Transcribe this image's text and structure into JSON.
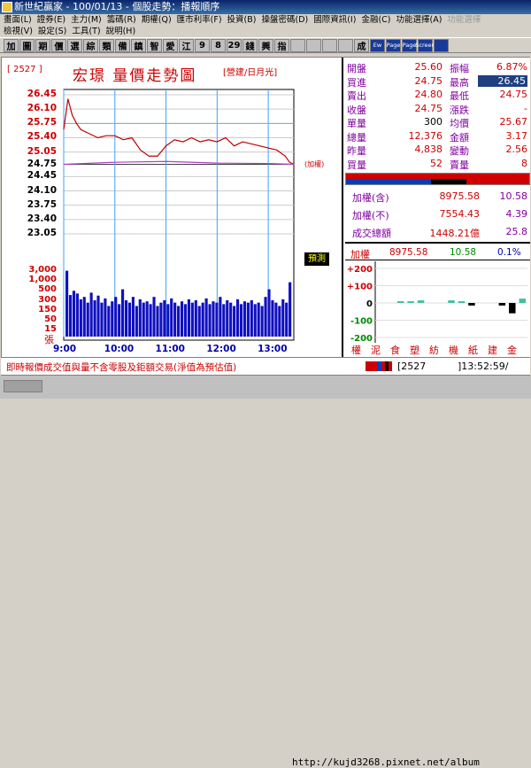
{
  "window": {
    "title": "新世紀贏家 - 100/01/13 - 個股走勢：播報順序"
  },
  "menu": {
    "row1": [
      {
        "label": "畫面(L)",
        "dim": false
      },
      {
        "label": "證券(E)",
        "dim": false
      },
      {
        "label": "主力(M)",
        "dim": false
      },
      {
        "label": "籌碼(R)",
        "dim": false
      },
      {
        "label": "期權(Q)",
        "dim": false
      },
      {
        "label": "匯市利率(F)",
        "dim": false
      },
      {
        "label": "投資(B)",
        "dim": false
      },
      {
        "label": "操盤密碼(D)",
        "dim": false
      },
      {
        "label": "國際資訊(I)",
        "dim": false
      },
      {
        "label": "金融(C)",
        "dim": false
      },
      {
        "label": "功能選擇(A)",
        "dim": false
      },
      {
        "label": "功能選擇",
        "dim": true
      }
    ],
    "row2": [
      {
        "label": "檢視(V)"
      },
      {
        "label": "設定(S)"
      },
      {
        "label": "工具(T)"
      },
      {
        "label": "說明(H)"
      }
    ]
  },
  "toolbar": {
    "buttons": [
      {
        "label": "加",
        "style": "normal"
      },
      {
        "label": "圖",
        "style": "normal"
      },
      {
        "label": "期",
        "style": "normal"
      },
      {
        "label": "價",
        "style": "normal"
      },
      {
        "label": "選",
        "style": "normal"
      },
      {
        "label": "綜",
        "style": "normal"
      },
      {
        "label": "類",
        "style": "normal"
      },
      {
        "label": "備",
        "style": "normal"
      },
      {
        "label": "鎮",
        "style": "normal"
      },
      {
        "label": "智",
        "style": "normal"
      },
      {
        "label": "愛",
        "style": "normal"
      },
      {
        "label": "江",
        "style": "normal"
      },
      {
        "label": "9",
        "style": "normal"
      },
      {
        "label": "8",
        "style": "normal"
      },
      {
        "label": "29",
        "style": "normal"
      },
      {
        "label": "錢",
        "style": "normal"
      },
      {
        "label": "興",
        "style": "normal"
      },
      {
        "label": "指",
        "style": "normal"
      },
      {
        "label": "",
        "style": "normal"
      },
      {
        "label": "",
        "style": "normal"
      },
      {
        "label": "",
        "style": "normal"
      },
      {
        "label": "",
        "style": "normal"
      },
      {
        "label": "成",
        "style": "normal"
      },
      {
        "label": "Ew",
        "style": "blue"
      },
      {
        "label": "Page",
        "style": "blue"
      },
      {
        "label": "Page",
        "style": "blue"
      },
      {
        "label": "Screen",
        "style": "blue"
      },
      {
        "label": "",
        "style": "blue"
      }
    ]
  },
  "stock": {
    "code": "[ 2527 ]",
    "name": "宏璟 量價走勢圖",
    "sector": "[營建/日月光]"
  },
  "chart_data": {
    "type": "line",
    "title": "宏璟 量價走勢圖",
    "xlabel": "",
    "ylabel": "",
    "x_ticks": [
      "9:00",
      "10:00",
      "11:00",
      "12:00",
      "13:00"
    ],
    "y_ticks": [
      "26.45",
      "26.10",
      "25.75",
      "25.40",
      "25.05",
      "24.75",
      "24.45",
      "24.10",
      "23.75",
      "23.40",
      "23.05"
    ],
    "ylim": [
      23.05,
      26.45
    ],
    "reference_price": 24.75,
    "series": [
      {
        "color": "#c00000",
        "x": [
          "9:00",
          "9:05",
          "9:10",
          "9:15",
          "9:20",
          "9:30",
          "9:40",
          "9:50",
          "10:00",
          "10:10",
          "10:20",
          "10:30",
          "10:40",
          "10:50",
          "11:00",
          "11:10",
          "11:20",
          "11:30",
          "11:40",
          "11:50",
          "12:00",
          "12:10",
          "12:20",
          "12:30",
          "12:40",
          "12:50",
          "13:00",
          "13:10",
          "13:20",
          "13:25",
          "13:30"
        ],
        "values": [
          25.6,
          26.35,
          25.95,
          25.75,
          25.6,
          25.5,
          25.4,
          25.45,
          25.45,
          25.35,
          25.4,
          25.1,
          24.95,
          24.95,
          25.2,
          25.35,
          25.3,
          25.4,
          25.3,
          25.35,
          25.3,
          25.4,
          25.2,
          25.3,
          25.25,
          25.2,
          25.15,
          25.1,
          24.95,
          24.8,
          24.75
        ]
      },
      {
        "color": "#b040c0",
        "x": [
          "9:00",
          "10:00",
          "11:00",
          "12:00",
          "13:00",
          "13:30"
        ],
        "values": [
          24.75,
          24.8,
          24.82,
          24.78,
          24.77,
          24.75
        ]
      }
    ],
    "annotations": [
      "(加權)",
      "預測"
    ],
    "volume": {
      "y_ticks": [
        "3,000",
        "1,000",
        "500",
        "300",
        "150",
        "50",
        "15"
      ],
      "unit": "張",
      "values": [
        2800,
        150,
        250,
        180,
        90,
        120,
        60,
        200,
        80,
        140,
        60,
        100,
        40,
        70,
        120,
        50,
        300,
        80,
        60,
        120,
        40,
        90,
        60,
        70,
        50,
        120,
        40,
        60,
        80,
        50,
        100,
        60,
        40,
        70,
        50,
        90,
        60,
        80,
        40,
        60,
        100,
        50,
        70,
        60,
        120,
        50,
        80,
        60,
        40,
        90,
        50,
        70,
        60,
        80,
        50,
        60,
        40,
        120,
        300,
        80,
        60,
        40,
        90,
        60,
        700
      ]
    }
  },
  "quote": {
    "rows": [
      {
        "l1": "開盤",
        "v1": "25.60",
        "l2": "振幅",
        "v2": "6.87%",
        "v2hl": false
      },
      {
        "l1": "買進",
        "v1": "24.75",
        "l2": "最高",
        "v2": "26.45",
        "v2hl": true
      },
      {
        "l1": "賣出",
        "v1": "24.80",
        "l2": "最低",
        "v2": "24.75",
        "v2hl": false
      },
      {
        "l1": "收盤",
        "v1": "24.75",
        "l2": "漲跌",
        "v2": "-",
        "v2hl": false
      },
      {
        "l1": "單量",
        "v1": "300",
        "l2": "均價",
        "v2": "25.67",
        "v2hl": false
      },
      {
        "l1": "總量",
        "v1": "12,376",
        "l2": "金額",
        "v2": "3.17",
        "v2hl": false
      },
      {
        "l1": "昨量",
        "v1": "4,838",
        "l2": "變動",
        "v2": "2.56",
        "v2hl": false
      },
      {
        "l1": "買量",
        "v1": "52",
        "l2": "賣量",
        "v2": "8",
        "v2hl": false
      }
    ]
  },
  "index": {
    "rows": [
      {
        "label": "加權(含)",
        "a": "8975.58",
        "b": "10.58"
      },
      {
        "label": "加權(不)",
        "a": "7554.43",
        "b": "4.39"
      },
      {
        "label": "成交總額",
        "a": "1448.21億",
        "b": "25.8"
      }
    ],
    "summary": {
      "label": "加權",
      "a": "8975.58",
      "b": "10.58",
      "c": "0.1%"
    },
    "sector_chart": {
      "y_ticks": [
        "+200",
        "+100",
        "0",
        "-100",
        "-200"
      ],
      "sectors": [
        "權",
        "泥",
        "食",
        "塑",
        "紡",
        "機",
        "紙",
        "建",
        "金"
      ],
      "values": [
        0,
        0,
        10,
        10,
        15,
        0,
        0,
        15,
        10,
        -15,
        0,
        0,
        -15,
        -60,
        25
      ]
    }
  },
  "statusbar": {
    "note": "即時報價成交值與量不含零股及鉅額交易(淨值為預估值)",
    "code": "[2527",
    "time": "]13:52:59/"
  },
  "footer": {
    "watermark": "http://kujd3268.pixnet.net/album"
  }
}
